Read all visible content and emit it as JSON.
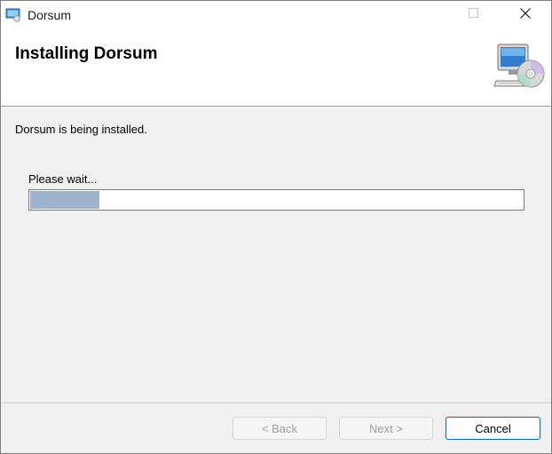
{
  "window": {
    "title": "Dorsum",
    "controls": {
      "minimize_icon": "minimize-icon",
      "maximize_icon": "maximize-icon",
      "close_icon": "close-icon"
    }
  },
  "banner": {
    "title": "Installing Dorsum",
    "icon": "computer-cd-icon"
  },
  "content": {
    "status": "Dorsum is being installed.",
    "wait_label": "Please wait...",
    "progress_fraction": 0.14,
    "progress_color": "#9db3ce"
  },
  "buttons": {
    "back": "< Back",
    "next": "Next >",
    "cancel": "Cancel"
  },
  "colors": {
    "accent": "#0067c0",
    "content_bg": "#f0f0f0"
  }
}
